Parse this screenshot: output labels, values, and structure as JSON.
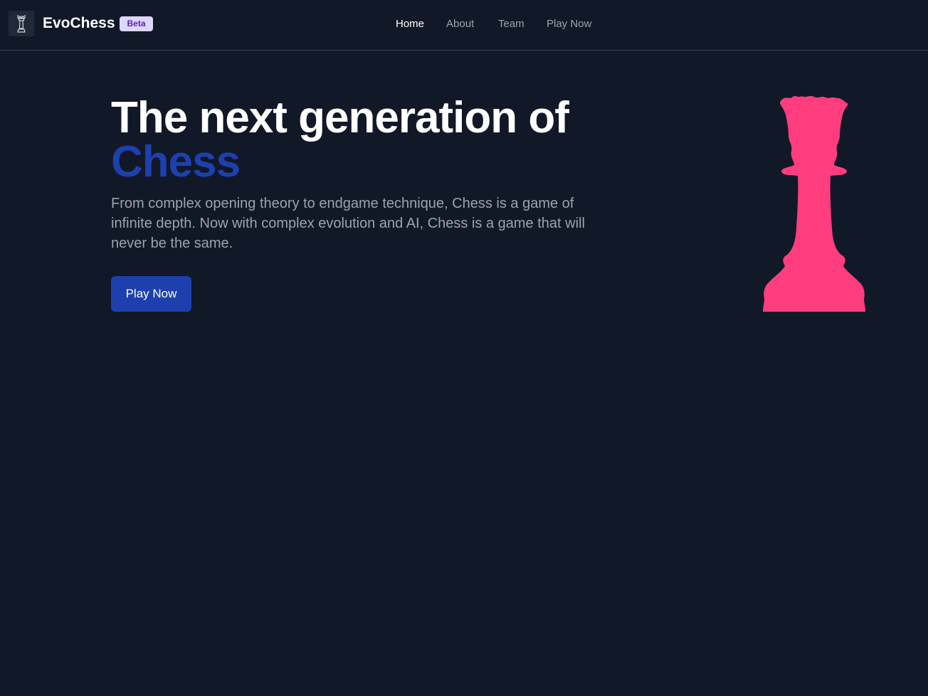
{
  "header": {
    "brand": "EvoChess",
    "badge": "Beta",
    "logo_icon": "chess-rook-icon",
    "nav": [
      {
        "label": "Home",
        "active": true
      },
      {
        "label": "About",
        "active": false
      },
      {
        "label": "Team",
        "active": false
      },
      {
        "label": "Play Now",
        "active": false
      }
    ]
  },
  "hero": {
    "title": "The next generation of",
    "title_accent": "Chess",
    "description": "From complex opening theory to endgame technique, Chess is a game of infinite depth. Now with complex evolution and AI, Chess is a game that will never be the same.",
    "cta_label": "Play Now",
    "illustration_icon": "chess-rook-icon"
  },
  "colors": {
    "background": "#111827",
    "accent": "#1e40af",
    "illustration": "#ff3d7f",
    "badge_bg": "#ddd6fe",
    "badge_text": "#5b21b6"
  }
}
